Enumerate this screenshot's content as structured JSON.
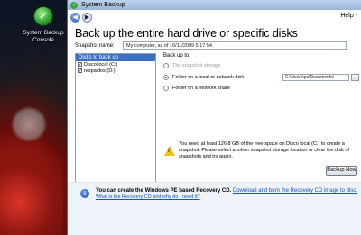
{
  "desktop": {
    "icon_label": "System Backup Console"
  },
  "window": {
    "title": "System Backup",
    "help_label": "Help -",
    "heading": "Back up the entire hard drive or specific disks"
  },
  "snapshot": {
    "label": "Snapshot name:",
    "value": "My computer, as of 10/11/2009 5:17:54"
  },
  "disks": {
    "header": "Disks to back up",
    "items": [
      {
        "label": "Disco local (C:)",
        "checked": true
      },
      {
        "label": "respaldos (D:)",
        "checked": true
      }
    ]
  },
  "backup_to": {
    "label": "Back up to:",
    "options": [
      {
        "label": "The snapshot storage",
        "selected": false,
        "enabled": false
      },
      {
        "label": "Folder on a local or network disk",
        "selected": true,
        "enabled": true
      },
      {
        "label": "Folder on a network share",
        "selected": false,
        "enabled": true
      }
    ],
    "path_value": "C:\\Users\\pc\\Documents\\",
    "browse_label": "..."
  },
  "warning": {
    "icon": "warning-icon",
    "text": "You need at least 126.8 GB of the free-space on Disco local (C:) to create a snapshot. Please select another snapshot storage location or clear the disk of snapshots and try again."
  },
  "actions": {
    "backup_now": "Backup Now"
  },
  "footer": {
    "bold_text": "You can create the Windows PE based Recovery CD.",
    "link1": "Download and burn the Recovery CD image to disc.",
    "link2": "What is the Recovery CD and why do I need it?"
  },
  "colors": {
    "accent": "#3a6fc4",
    "link": "#1a4fbf",
    "warning": "#f0c21a"
  }
}
